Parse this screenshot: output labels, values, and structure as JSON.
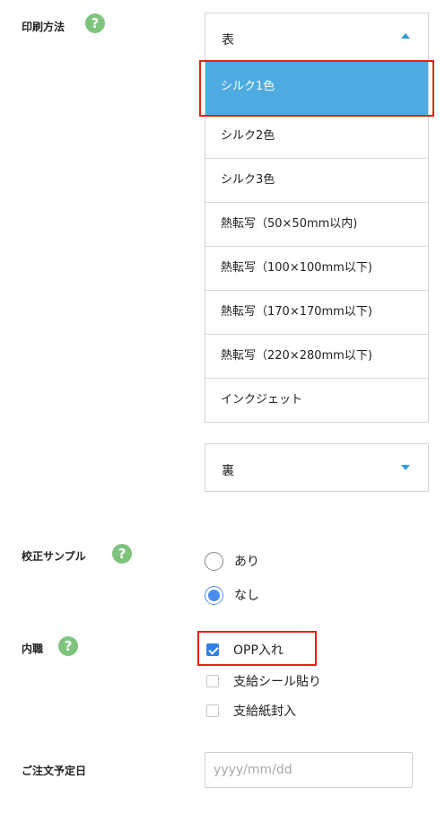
{
  "print_method": {
    "label": "印刷方法",
    "help_icon": "?",
    "front": {
      "value": "表",
      "options": [
        "シルク1色",
        "シルク2色",
        "シルク3色",
        "熱転写（50×50mm以内)",
        "熱転写（100×100mm以下)",
        "熱転写（170×170mm以下)",
        "熱転写（220×280mm以下)",
        "インクジェット"
      ],
      "selected_option": "シルク1色"
    },
    "back": {
      "value": "裏"
    }
  },
  "proof_sample": {
    "label": "校正サンプル",
    "help_icon": "?",
    "options": [
      {
        "label": "あり",
        "checked": false
      },
      {
        "label": "なし",
        "checked": true
      }
    ]
  },
  "inner_packaging": {
    "label": "内職",
    "help_icon": "?",
    "options": [
      {
        "label": "OPP入れ",
        "checked": true
      },
      {
        "label": "支給シール貼り",
        "checked": false
      },
      {
        "label": "支給紙封入",
        "checked": false
      }
    ]
  },
  "order_date": {
    "label": "ご注文予定日",
    "placeholder": "yyyy/mm/dd"
  },
  "colors": {
    "accent": "#4dabe2",
    "help_icon_bg": "#7fc47d",
    "highlight": "#e0221b",
    "radio_checked": "#4a8ef0",
    "checkbox_checked": "#2f7ee8"
  }
}
